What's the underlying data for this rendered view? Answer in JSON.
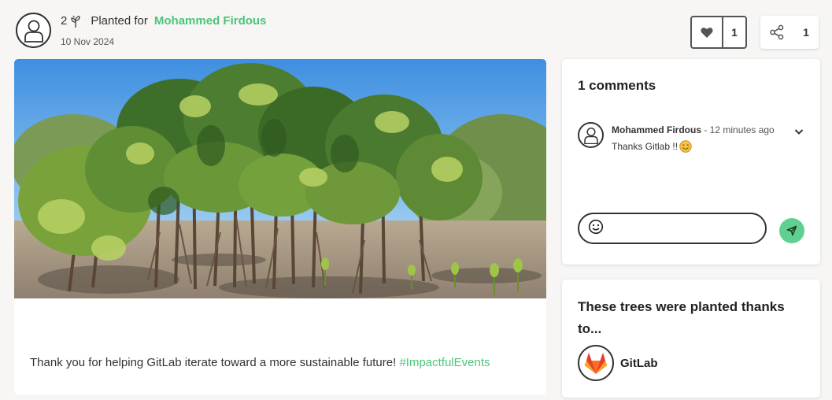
{
  "post": {
    "tree_count": "2",
    "planted_for_label": "Planted for",
    "recipient": "Mohammed Firdous",
    "date": "10 Nov 2024",
    "caption_text": "Thank you for helping GitLab iterate toward a more sustainable future! ",
    "hashtag": "#ImpactfulEvents",
    "photo_icon": "mangrove-trees-photo"
  },
  "actions": {
    "like_count": "1",
    "share_count": "1",
    "like_icon": "heart-icon",
    "share_icon": "share-icon"
  },
  "comments": {
    "title": "1 comments",
    "items": [
      {
        "author": "Mohammed Firdous",
        "time": " - 12 minutes ago",
        "text": "Thanks Gitlab !!",
        "emoji": "smiling-face-icon"
      }
    ],
    "input_icon": "emoji-icon",
    "send_icon": "send-icon"
  },
  "sponsor": {
    "title": "These trees were planted thanks to...",
    "name": "GitLab",
    "logo_icon": "gitlab-logo"
  },
  "colors": {
    "accent_green": "#4cc47b",
    "send_button": "#5fd08f",
    "page_background": "#f7f6f4"
  }
}
